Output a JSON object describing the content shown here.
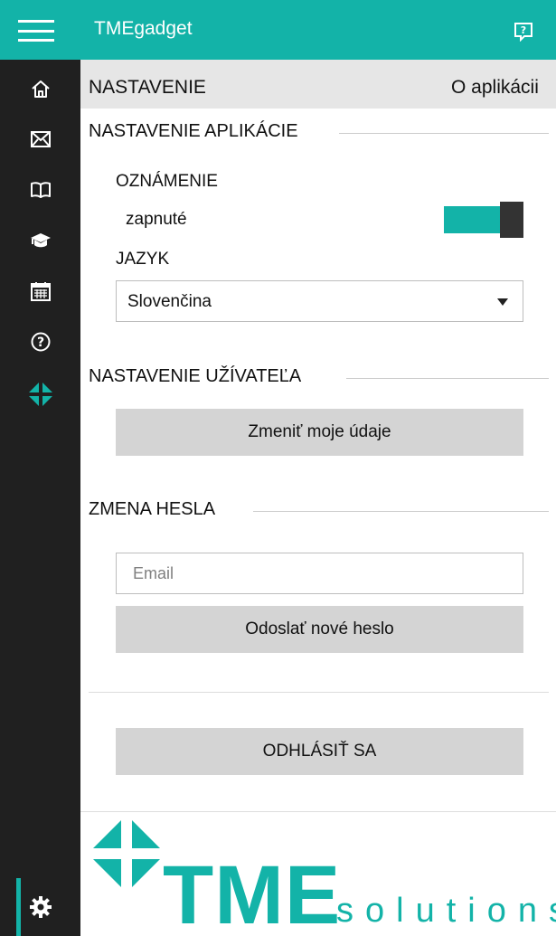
{
  "app": {
    "title": "TMEgadget"
  },
  "header": {
    "tab_settings": "NASTAVENIE",
    "tab_about": "O aplikácii"
  },
  "app_settings": {
    "heading": "NASTAVENIE APLIKÁCIE",
    "notification_label": "OZNÁMENIE",
    "notification_state": "zapnuté",
    "notification_on": true,
    "language_label": "JAZYK",
    "language_value": "Slovenčina"
  },
  "user_settings": {
    "heading": "NASTAVENIE UŽÍVATEĽA",
    "change_data_button": "Zmeniť moje údaje"
  },
  "password": {
    "heading": "ZMENA HESLA",
    "email_placeholder": "Email",
    "email_value": "",
    "send_button": "Odoslať nové heslo"
  },
  "logout": {
    "button": "ODHLÁSIŤ SA"
  },
  "logo": {
    "main": "TME",
    "sub": "solutions"
  },
  "sidebar": {
    "items": [
      {
        "icon": "home-icon"
      },
      {
        "icon": "mail-icon"
      },
      {
        "icon": "book-icon"
      },
      {
        "icon": "graduation-cap-icon"
      },
      {
        "icon": "calendar-icon"
      },
      {
        "icon": "help-icon"
      },
      {
        "icon": "tme-logo-icon"
      },
      {
        "icon": "gear-icon",
        "active": true
      }
    ]
  },
  "colors": {
    "accent": "#13b3a8",
    "sidebar": "#202020",
    "button": "#d4d4d4",
    "header_strip": "#e6e6e6"
  }
}
